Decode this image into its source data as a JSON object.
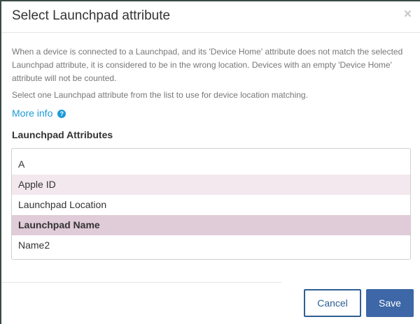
{
  "dialog": {
    "title": "Select Launchpad attribute",
    "close_symbol": "×",
    "description": "When a device is connected to a Launchpad, and its 'Device Home' attribute does not match the selected Launchpad attribute, it is considered to be in the wrong location. Devices with an empty 'Device Home' attribute will not be counted.",
    "instruction": "Select one Launchpad attribute from the list to use for device location matching.",
    "more_info_label": "More info",
    "help_icon_glyph": "?",
    "section_label": "Launchpad Attributes"
  },
  "attributes": [
    {
      "label": "A"
    },
    {
      "label": "Apple ID"
    },
    {
      "label": "Launchpad Location"
    },
    {
      "label": "Launchpad Name"
    },
    {
      "label": "Name2"
    }
  ],
  "selected_attribute": "Launchpad Name",
  "footer": {
    "cancel_label": "Cancel",
    "save_label": "Save"
  },
  "colors": {
    "accent": "#3d67a6",
    "link": "#1a9bd7",
    "row_alt": "#f2e8ee",
    "row_selected": "#e0cbd8"
  },
  "icons": {
    "close": "close-icon",
    "help": "help-circle-icon"
  }
}
